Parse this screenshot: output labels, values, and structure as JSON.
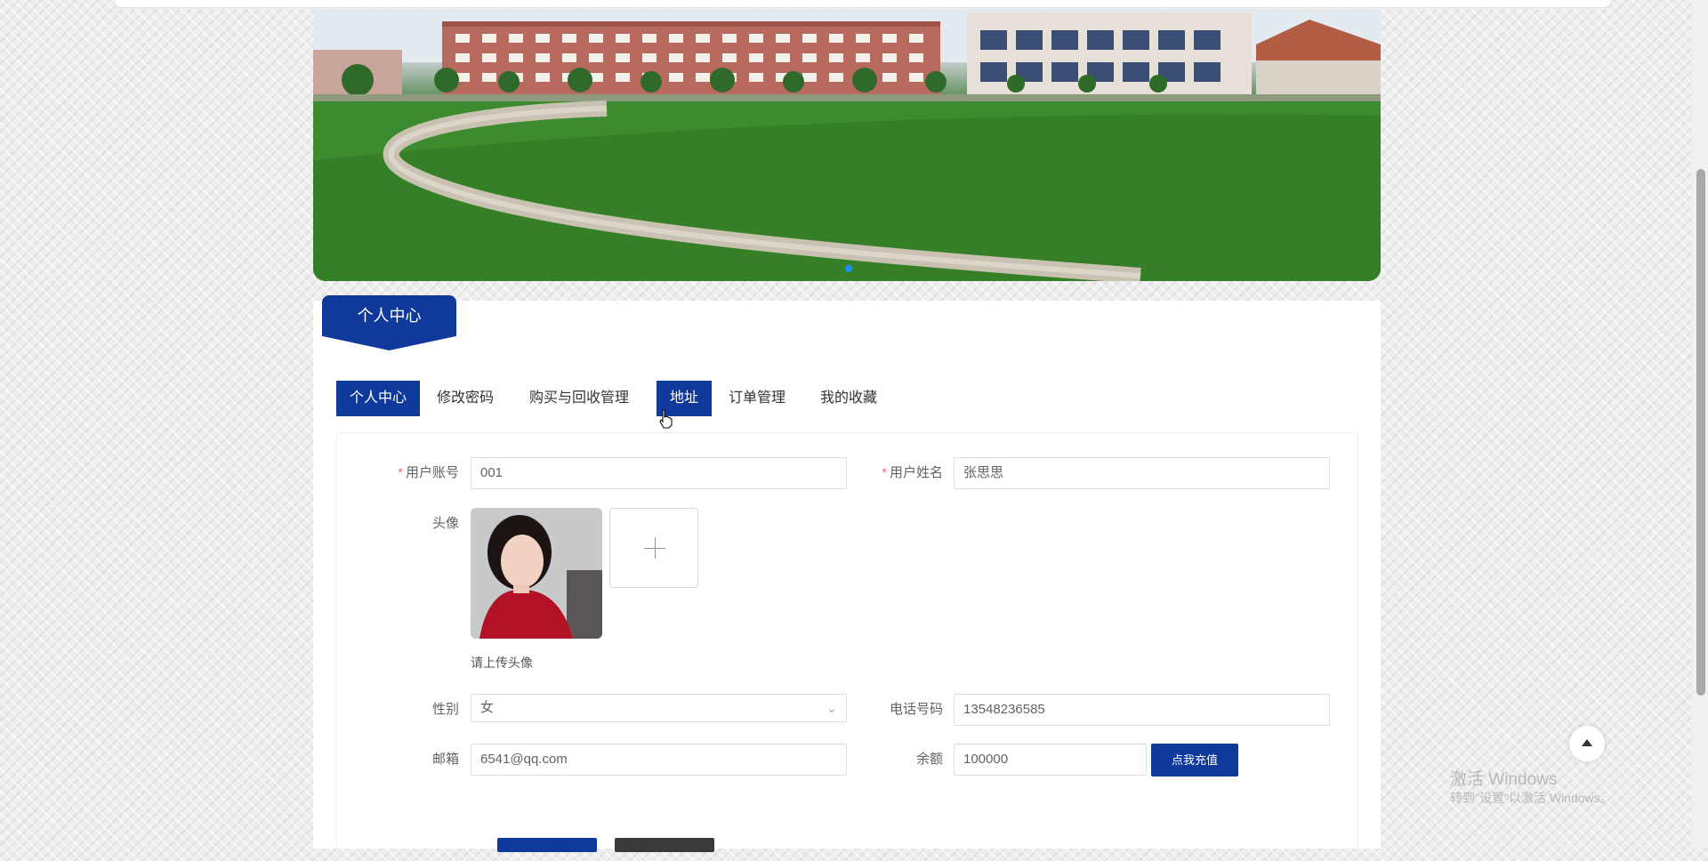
{
  "banner": {
    "alt": "campus-banner"
  },
  "section": {
    "title": "个人中心"
  },
  "tabs": [
    {
      "label": "个人中心"
    },
    {
      "label": "修改密码"
    },
    {
      "label": "购买与回收管理"
    },
    {
      "label": "地址"
    },
    {
      "label": "订单管理"
    },
    {
      "label": "我的收藏"
    }
  ],
  "form": {
    "account_label": "用户账号",
    "account_value": "001",
    "name_label": "用户姓名",
    "name_value": "张思思",
    "avatar_label": "头像",
    "avatar_hint": "请上传头像",
    "gender_label": "性别",
    "gender_value": "女",
    "phone_label": "电话号码",
    "phone_value": "13548236585",
    "email_label": "邮箱",
    "email_value": "6541@qq.com",
    "balance_label": "余额",
    "balance_value": "100000",
    "recharge_label": "点我充值",
    "required_mark": "*"
  },
  "colors": {
    "primary": "#0f3a9c",
    "danger": "#f56c6c"
  },
  "icons": {
    "upload": "plus-icon",
    "select": "chevron-down-icon",
    "backtop": "caret-up-icon"
  },
  "watermark": {
    "line1": "激活 Windows",
    "line2": "转到\"设置\"以激活 Windows。"
  }
}
